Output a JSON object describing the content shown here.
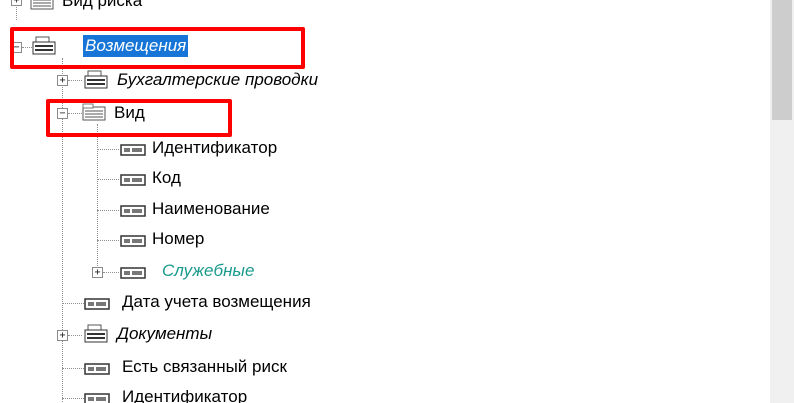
{
  "tree": {
    "nodes": [
      {
        "label": "Вид риска",
        "icon": "table-icon",
        "style": "normal"
      },
      {
        "label": "Возмещения",
        "icon": "table-group-icon",
        "style": "italic-selected"
      },
      {
        "label": "Бухгалтерские проводки",
        "icon": "table-group-icon",
        "style": "italic"
      },
      {
        "label": "Вид",
        "icon": "table-icon",
        "style": "normal"
      },
      {
        "label": "Идентификатор",
        "icon": "field-icon",
        "style": "normal"
      },
      {
        "label": "Код",
        "icon": "field-icon",
        "style": "normal"
      },
      {
        "label": "Наименование",
        "icon": "field-icon",
        "style": "normal"
      },
      {
        "label": "Номер",
        "icon": "field-icon",
        "style": "normal"
      },
      {
        "label": "Служебные",
        "icon": "field-icon",
        "style": "italic-teal"
      },
      {
        "label": "Дата учета возмещения",
        "icon": "field-icon",
        "style": "normal"
      },
      {
        "label": "Документы",
        "icon": "table-group-icon",
        "style": "italic"
      },
      {
        "label": "Есть связанный риск",
        "icon": "field-icon",
        "style": "normal"
      },
      {
        "label": "Идентификатор",
        "icon": "field-icon",
        "style": "normal"
      }
    ],
    "toggles": {
      "expanded": "−",
      "collapsed": "+"
    }
  },
  "annotations": {
    "highlight_color": "#ff0000"
  },
  "colors": {
    "selection": "#1675d6",
    "teal_text": "#1a9a8c"
  }
}
